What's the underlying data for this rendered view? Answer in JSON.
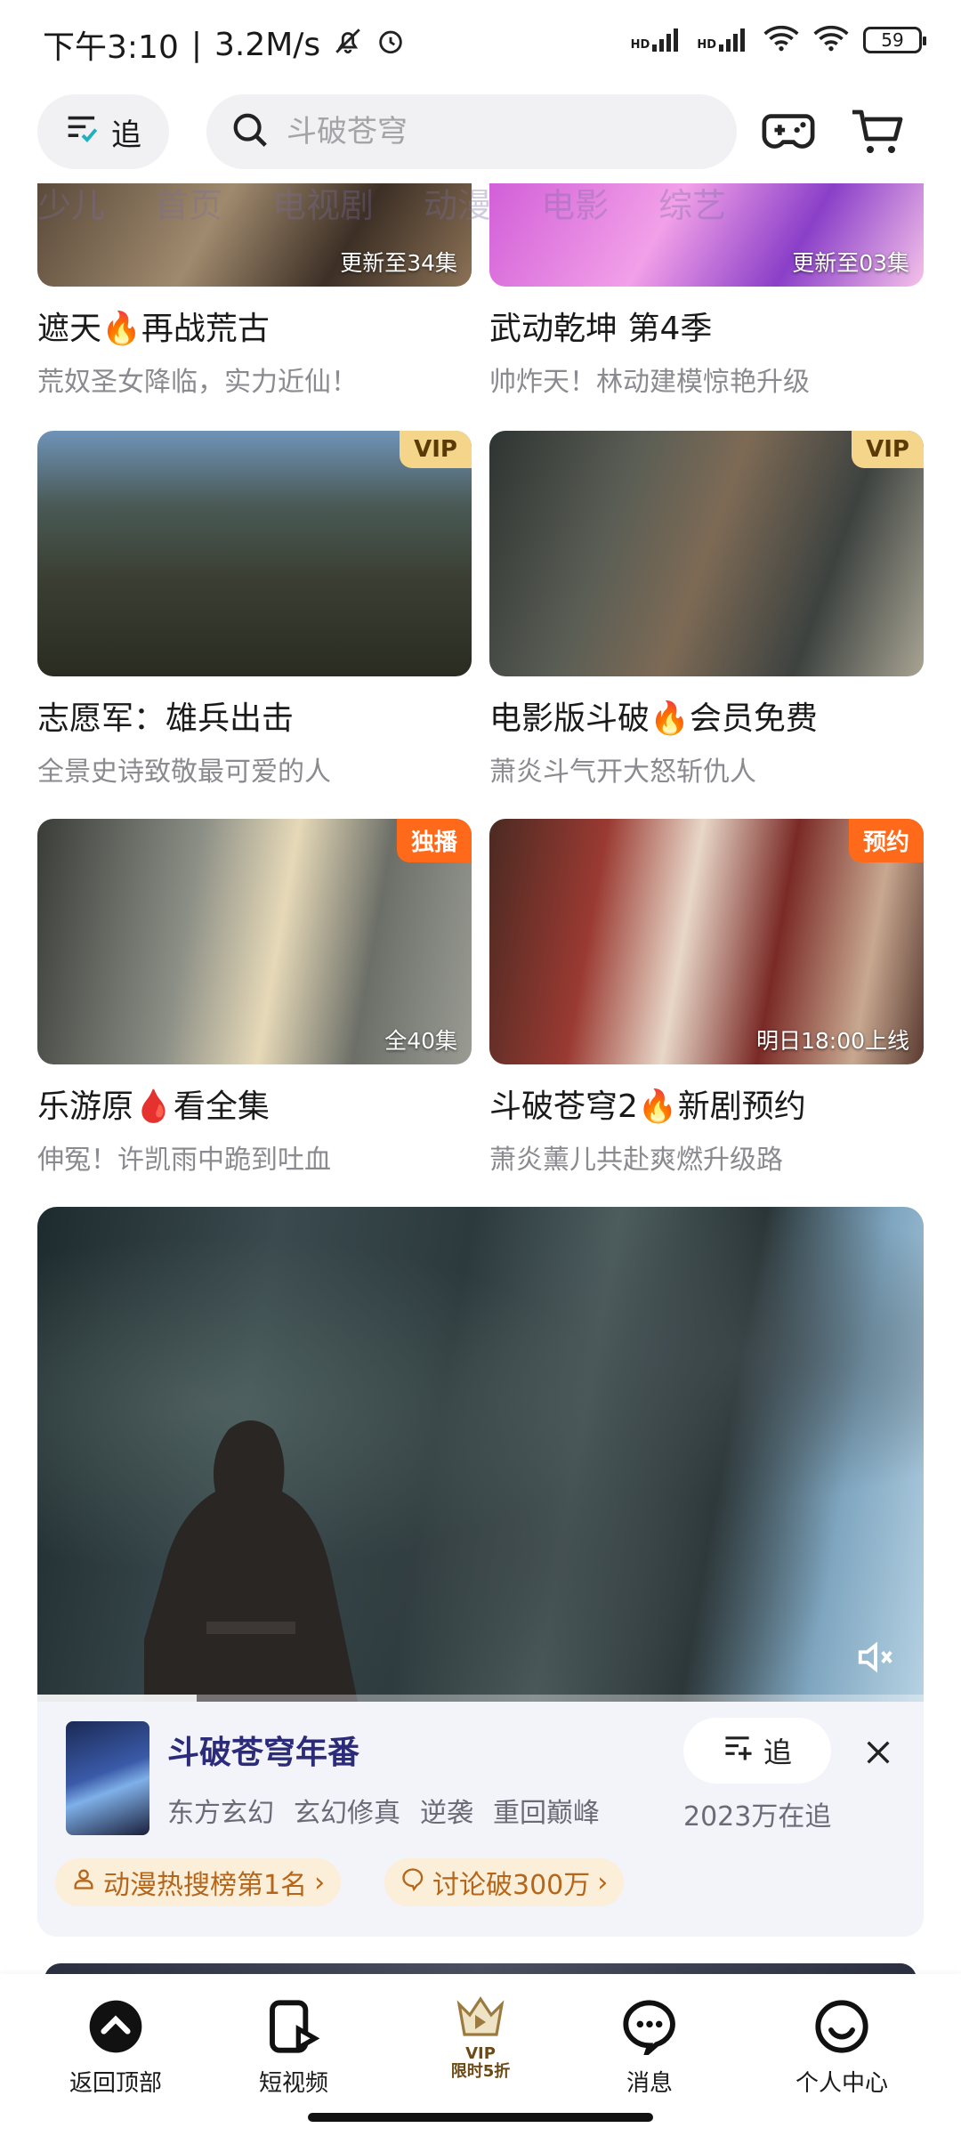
{
  "status_bar": {
    "time": "下午3:10",
    "network_speed": "3.2M/s",
    "separator": "|",
    "network_1": "HD",
    "network_2": "HD",
    "battery": "59"
  },
  "header": {
    "follow_label": "追",
    "search_placeholder": "斗破苍穹"
  },
  "category_strip": [
    "少儿",
    "首页",
    "电视剧",
    "动漫",
    "电影",
    "综艺"
  ],
  "cards": [
    {
      "title": "遮天🔥再战荒古",
      "subtitle": "荒奴圣女降临，实力近仙！",
      "overlay": "更新至34集",
      "badge": ""
    },
    {
      "title": "武动乾坤 第4季",
      "subtitle": "帅炸天！林动建模惊艳升级",
      "overlay": "更新至03集",
      "badge": ""
    },
    {
      "title": "志愿军：雄兵出击",
      "subtitle": "全景史诗致敬最可爱的人",
      "overlay": "",
      "badge": "VIP"
    },
    {
      "title": "电影版斗破🔥会员免费",
      "subtitle": "萧炎斗气开大怒斩仇人",
      "overlay": "",
      "badge": "VIP"
    },
    {
      "title": "乐游原🩸看全集",
      "subtitle": "伸冤！许凯雨中跪到吐血",
      "overlay": "全40集",
      "badge": "独播"
    },
    {
      "title": "斗破苍穹2🔥新剧预约",
      "subtitle": "萧炎薰儿共赴爽燃升级路",
      "overlay": "明日18:00上线",
      "badge": "预约"
    }
  ],
  "featured": {
    "title": "斗破苍穹年番",
    "tags": [
      "东方玄幻",
      "玄幻修真",
      "逆袭",
      "重回巅峰"
    ],
    "follow_label": "追",
    "follow_count": "2023万在追",
    "chips": [
      "动漫热搜榜第1名",
      "讨论破300万"
    ],
    "progress": 0.18
  },
  "bottom_nav": {
    "items": [
      "返回顶部",
      "短视频",
      "消息",
      "个人中心"
    ],
    "vip_line1": "VIP",
    "vip_line2": "限时5折"
  },
  "colors": {
    "badge_vip_bg": "#f4d58a",
    "badge_orange_bg": "#ff6a1a",
    "featured_title": "#2b2b7a",
    "chip_text": "#b5661a"
  }
}
